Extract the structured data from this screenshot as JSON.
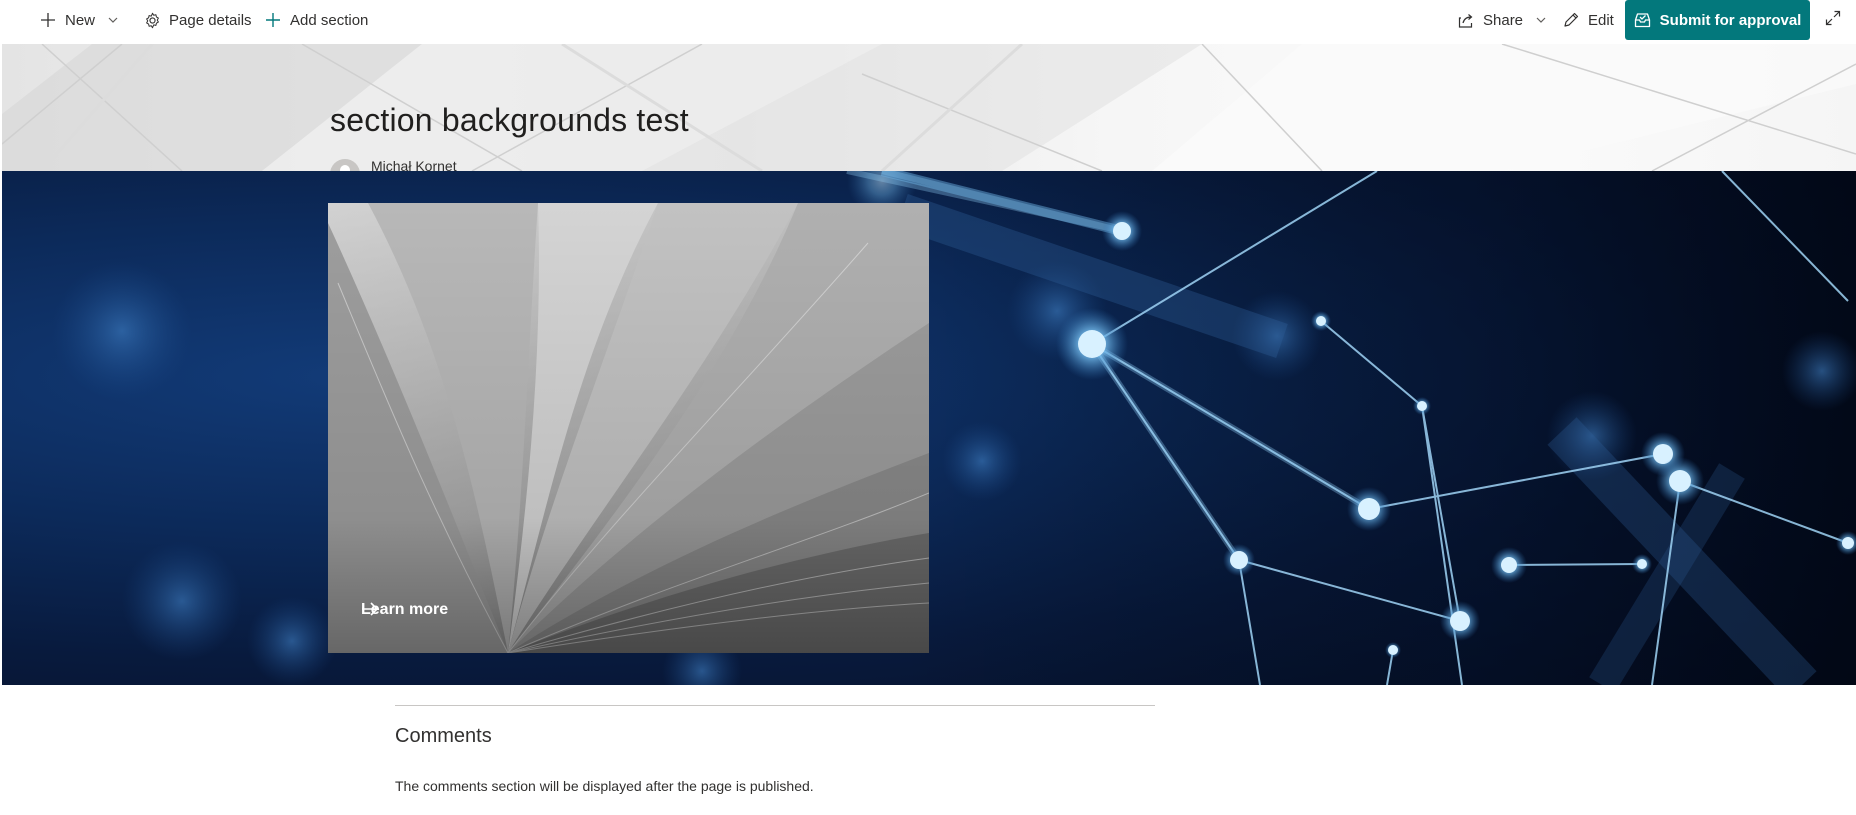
{
  "commandbar": {
    "new_label": "New",
    "page_details_label": "Page details",
    "add_section_label": "Add section",
    "share_label": "Share",
    "edit_label": "Edit",
    "submit_label": "Submit for approval",
    "accent_color": "#03787c"
  },
  "title_region": {
    "title": "section backgrounds test",
    "author": "Michał Kornet"
  },
  "hero": {
    "tile_link_label": "Learn more",
    "background_color": "#0c2a5a"
  },
  "comments": {
    "heading": "Comments",
    "note": "The comments section will be displayed after the page is published."
  }
}
